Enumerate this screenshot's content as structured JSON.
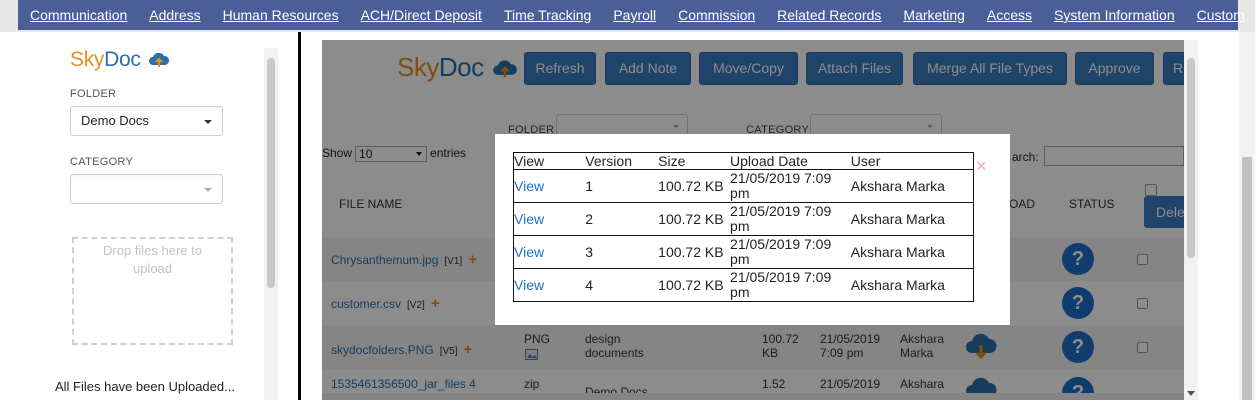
{
  "nav": [
    "Communication",
    "Address",
    "Human Resources",
    "ACH/Direct Deposit",
    "Time Tracking",
    "Payroll",
    "Commission",
    "Related Records",
    "Marketing",
    "Access",
    "System Information",
    "Custom"
  ],
  "left": {
    "logo_sky": "Sky",
    "logo_doc": "Doc",
    "folder_label": "FOLDER",
    "folder_value": "Demo Docs",
    "category_label": "CATEGORY",
    "category_value": "",
    "dropzone": "Drop files here to upload",
    "uploaded_message": "All Files have been Uploaded..."
  },
  "right": {
    "logo_sky": "Sky",
    "logo_doc": "Doc",
    "buttons": [
      "Refresh",
      "Add Note",
      "Move/Copy",
      "Attach Files",
      "Merge All File Types",
      "Approve",
      "R"
    ],
    "folder_label": "FOLDER",
    "category_label": "CATEGORY",
    "show_label": "Show",
    "show_value": "10",
    "entries_label": "entries",
    "search_label": "arch:",
    "headers": {
      "file_name": "FILE NAME",
      "download": "OAD",
      "status": "STATUS"
    },
    "delete_label": "Dele",
    "rows": [
      {
        "name": "Chrysanthemum.jpg",
        "ver": "[V1]",
        "type": "",
        "category": "",
        "size": "",
        "date": "",
        "user": ""
      },
      {
        "name": "customer.csv",
        "ver": "[V2]",
        "type": "",
        "category": "",
        "size": "",
        "date": "",
        "user": ""
      },
      {
        "name": "skydocfolders.PNG",
        "ver": "[V5]",
        "type": "PNG",
        "category": "design documents",
        "size": "100.72 KB",
        "date": "21/05/2019 7:09 pm",
        "user": "Akshara Marka"
      },
      {
        "name": "1535461356500_jar_files 4",
        "ver": "",
        "type": "zip",
        "category": "Demo Docs",
        "size": "1.52",
        "date": "21/05/2019",
        "user": "Akshara"
      }
    ]
  },
  "modal": {
    "headers": [
      "View",
      "Version",
      "Size",
      "Upload Date",
      "User"
    ],
    "rows": [
      {
        "view": "View",
        "version": "1",
        "size": "100.72 KB",
        "date": "21/05/2019 7:09 pm",
        "user": "Akshara Marka"
      },
      {
        "view": "View",
        "version": "2",
        "size": "100.72 KB",
        "date": "21/05/2019 7:09 pm",
        "user": "Akshara Marka"
      },
      {
        "view": "View",
        "version": "3",
        "size": "100.72 KB",
        "date": "21/05/2019 7:09 pm",
        "user": "Akshara Marka"
      },
      {
        "view": "View",
        "version": "4",
        "size": "100.72 KB",
        "date": "21/05/2019 7:09 pm",
        "user": "Akshara Marka"
      }
    ],
    "close": "×"
  },
  "colors": {
    "nav": "#4a5e98",
    "button": "#3b7bbf",
    "brand_orange": "#e38f1c",
    "brand_blue": "#2d6fa8",
    "status": "#1e6fc9"
  }
}
